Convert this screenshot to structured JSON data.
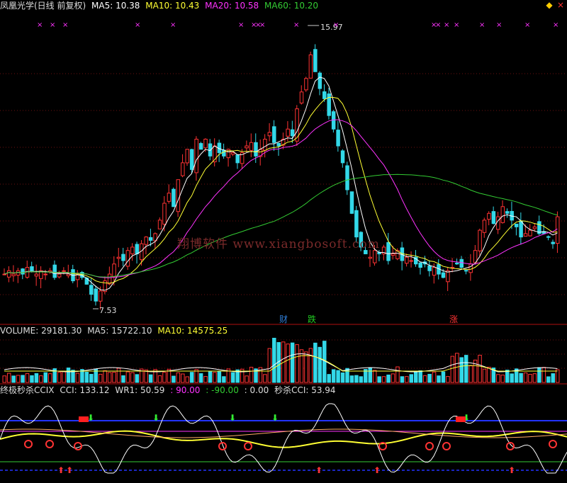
{
  "header": {
    "title": "凤凰光学(日线 前复权)",
    "ma5_label": "MA5: 10.38",
    "ma10_label": "MA10: 10.43",
    "ma20_label": "MA20: 10.58",
    "ma60_label": "MA60: 10.20"
  },
  "price": {
    "high_label": "15.97",
    "low_label": "7.53",
    "watermark": "翔博软件 www.xiangbosoft.com",
    "tags": [
      {
        "text": "财",
        "color": "#2f7ed8"
      },
      {
        "text": "跌",
        "color": "#22cc22"
      },
      {
        "text": "涨",
        "color": "#ff3333"
      }
    ]
  },
  "volume": {
    "label": "VOLUME: 29181.30",
    "ma5": "MA5: 15722.10",
    "ma10": "MA10: 14575.25"
  },
  "indicator": {
    "name": "终极秒杀CCIX",
    "cci": "CCI: 133.12",
    "wr1": "WR1: 50.59",
    "v90": ": 90.00",
    "vm90": ": -90.00",
    "v0": ": 0.00",
    "miaosha": "秒杀CCI: 53.94"
  },
  "controls": {
    "close": "×",
    "zoom": "◆"
  },
  "colors": {
    "up": "#ff3333",
    "down": "#33d8e8",
    "ma5": "#ffffff",
    "ma10": "#ffff33",
    "ma20": "#ff33ff",
    "ma60": "#33cc33",
    "label": "#dddddd"
  },
  "chart_data": {
    "type": "candlestick",
    "closes": [
      8.6,
      8.7,
      8.6,
      8.7,
      8.6,
      8.8,
      8.7,
      8.6,
      8.7,
      8.6,
      8.7,
      8.5,
      8.6,
      8.7,
      8.6,
      8.4,
      8.6,
      8.5,
      8.3,
      8.0,
      7.8,
      8.1,
      8.4,
      8.6,
      8.9,
      9.1,
      9.0,
      9.3,
      9.4,
      9.2,
      9.5,
      9.7,
      9.6,
      9.8,
      10.2,
      10.7,
      11.0,
      10.6,
      11.4,
      11.9,
      12.3,
      11.7,
      12.6,
      12.3,
      12.6,
      12.1,
      12.4,
      12.2,
      12.1,
      12.3,
      12.2,
      11.9,
      12.2,
      12.4,
      12.5,
      12.1,
      12.3,
      12.6,
      12.8,
      12.5,
      12.4,
      12.6,
      12.9,
      12.7,
      13.5,
      14.0,
      14.4,
      15.1,
      14.6,
      14.1,
      13.8,
      13.3,
      12.9,
      12.4,
      11.9,
      11.1,
      10.4,
      9.7,
      9.4,
      9.2,
      9.1,
      9.3,
      9.2,
      9.4,
      9.0,
      9.2,
      9.3,
      9.0,
      9.1,
      9.0,
      8.9,
      8.8,
      8.9,
      8.7,
      8.8,
      8.6,
      8.5,
      8.7,
      8.8,
      8.9,
      8.8,
      8.7,
      8.9,
      9.3,
      9.9,
      10.2,
      10.4,
      10.1,
      10.3,
      10.6,
      10.4,
      10.2,
      10.0,
      9.7,
      9.8,
      9.9,
      10.0,
      9.8,
      9.8,
      9.7,
      9.5,
      10.3
    ],
    "date_range": "approx. 120 daily bars",
    "ylim": [
      7.53,
      15.97
    ],
    "series": [
      {
        "name": "MA5",
        "value": 10.38
      },
      {
        "name": "MA10",
        "value": 10.43
      },
      {
        "name": "MA20",
        "value": 10.58
      },
      {
        "name": "MA60",
        "value": 10.2
      }
    ],
    "volume_series": [
      {
        "name": "VOLUME",
        "value": 29181.3
      },
      {
        "name": "MA5",
        "value": 15722.1
      },
      {
        "name": "MA10",
        "value": 14575.25
      }
    ],
    "indicator_series": [
      {
        "name": "CCI",
        "value": 133.12
      },
      {
        "name": "WR1",
        "value": 50.59
      },
      {
        "name": "秒杀CCI",
        "value": 53.94
      }
    ],
    "indicator_levels": [
      90,
      -90,
      0
    ]
  }
}
